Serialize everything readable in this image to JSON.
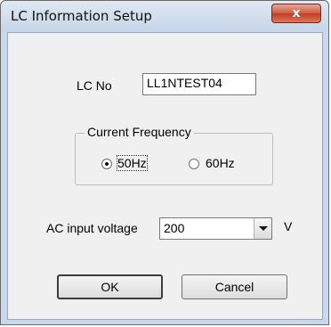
{
  "window": {
    "title": "LC Information Setup",
    "close_label": "x"
  },
  "lc_no": {
    "label": "LC No",
    "value": "LL1NTEST04"
  },
  "frequency": {
    "group_label": "Current Frequency",
    "options": [
      {
        "label": "50Hz",
        "selected": true
      },
      {
        "label": "60Hz",
        "selected": false
      }
    ]
  },
  "voltage": {
    "label": "AC input voltage",
    "value": "200",
    "unit": "V"
  },
  "buttons": {
    "ok": "OK",
    "cancel": "Cancel"
  }
}
